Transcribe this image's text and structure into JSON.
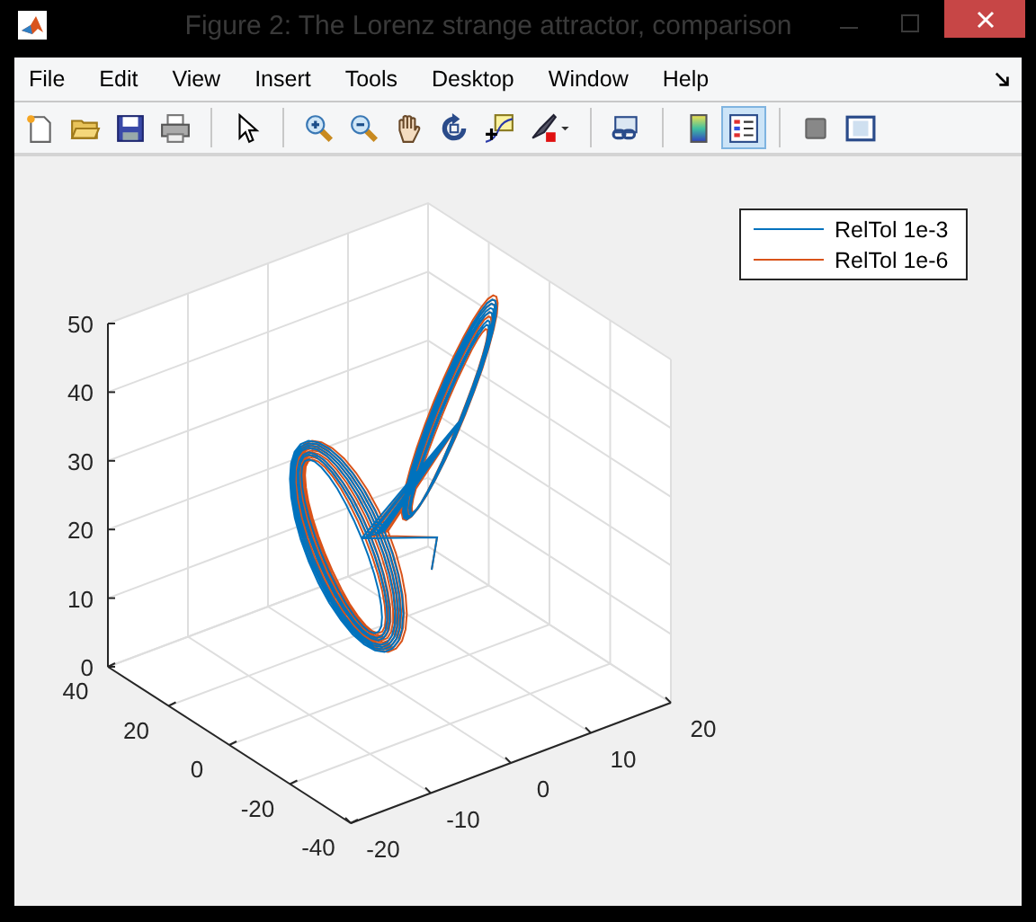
{
  "window": {
    "title": "Figure 2: The Lorenz strange attractor, comparison"
  },
  "menu": [
    {
      "label": "File"
    },
    {
      "label": "Edit"
    },
    {
      "label": "View"
    },
    {
      "label": "Insert"
    },
    {
      "label": "Tools"
    },
    {
      "label": "Desktop"
    },
    {
      "label": "Window"
    },
    {
      "label": "Help"
    }
  ],
  "toolbar": [
    {
      "kind": "new",
      "selected": false
    },
    {
      "kind": "open",
      "selected": false
    },
    {
      "kind": "save",
      "selected": false
    },
    {
      "kind": "print",
      "selected": false
    },
    {
      "kind": "sep"
    },
    {
      "kind": "pointer",
      "selected": false
    },
    {
      "kind": "sep"
    },
    {
      "kind": "zoomin",
      "selected": false
    },
    {
      "kind": "zoomout",
      "selected": false
    },
    {
      "kind": "pan",
      "selected": false
    },
    {
      "kind": "rotate",
      "selected": false
    },
    {
      "kind": "cursor",
      "selected": false
    },
    {
      "kind": "brush",
      "selected": false
    },
    {
      "kind": "sep"
    },
    {
      "kind": "link",
      "selected": false
    },
    {
      "kind": "sep"
    },
    {
      "kind": "colorbar",
      "selected": false
    },
    {
      "kind": "legend",
      "selected": true
    },
    {
      "kind": "sep"
    },
    {
      "kind": "hide",
      "selected": false
    },
    {
      "kind": "show",
      "selected": false
    }
  ],
  "axes": {
    "z_ticks": [
      "50",
      "40",
      "30",
      "20",
      "10",
      "0"
    ],
    "y_ticks": [
      "40",
      "20",
      "0",
      "-20",
      "-40"
    ],
    "x_ticks": [
      "-20",
      "-10",
      "0",
      "10",
      "20"
    ]
  },
  "legend": [
    {
      "label": "RelTol 1e-3",
      "color": "#0072bd"
    },
    {
      "label": "RelTol 1e-6",
      "color": "#d95319"
    }
  ]
}
